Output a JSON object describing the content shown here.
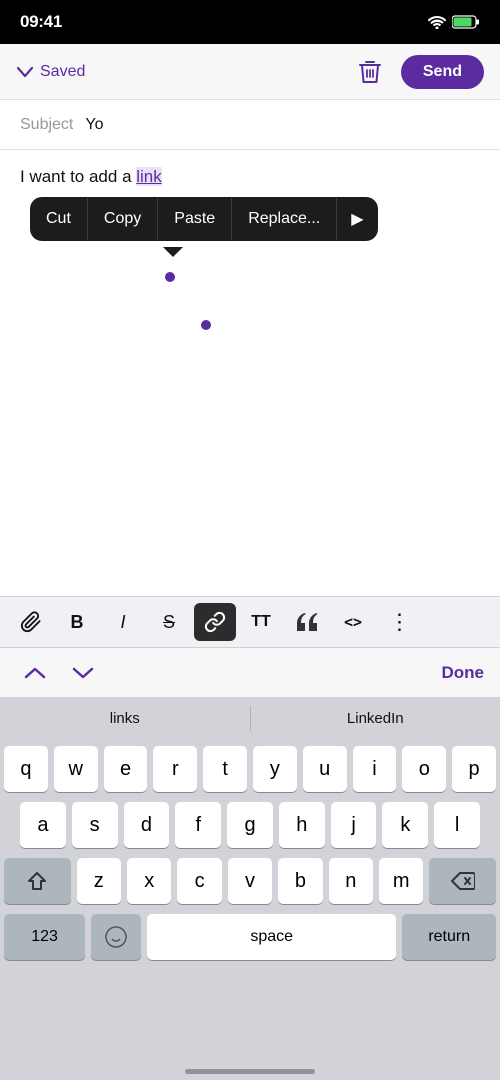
{
  "status_bar": {
    "time": "09:41",
    "wifi_icon": "wifi-icon",
    "battery_icon": "battery-icon"
  },
  "top_bar": {
    "saved_label": "Saved",
    "delete_label": "delete",
    "send_label": "Send"
  },
  "subject": {
    "label": "Subject",
    "value": "Yo"
  },
  "context_menu": {
    "cut": "Cut",
    "copy": "Copy",
    "paste": "Paste",
    "replace": "Replace...",
    "more_icon": "▶"
  },
  "body": {
    "text_before": "I want to add a ",
    "link_text": "link",
    "text_after": ""
  },
  "format_toolbar": {
    "attachment_icon": "📎",
    "bold_label": "B",
    "italic_label": "I",
    "strikethrough_label": "S",
    "link_label": "🔗",
    "text_size_label": "TT",
    "quote_label": "\"",
    "code_label": "<>",
    "more_label": "⋮"
  },
  "nav_row": {
    "up_arrow": "∧",
    "down_arrow": "∨",
    "done_label": "Done"
  },
  "predictive": {
    "item1": "links",
    "item2": "LinkedIn"
  },
  "keyboard": {
    "row1": [
      "q",
      "w",
      "e",
      "r",
      "t",
      "y",
      "u",
      "i",
      "o",
      "p"
    ],
    "row2": [
      "a",
      "s",
      "d",
      "f",
      "g",
      "h",
      "j",
      "k",
      "l"
    ],
    "row3": [
      "z",
      "x",
      "c",
      "v",
      "b",
      "n",
      "m"
    ],
    "bottom": {
      "num": "123",
      "space": "space",
      "return": "return"
    }
  },
  "colors": {
    "purple": "#5b2ca0",
    "black": "#1c1c1e",
    "bg": "#f7f7f8"
  }
}
